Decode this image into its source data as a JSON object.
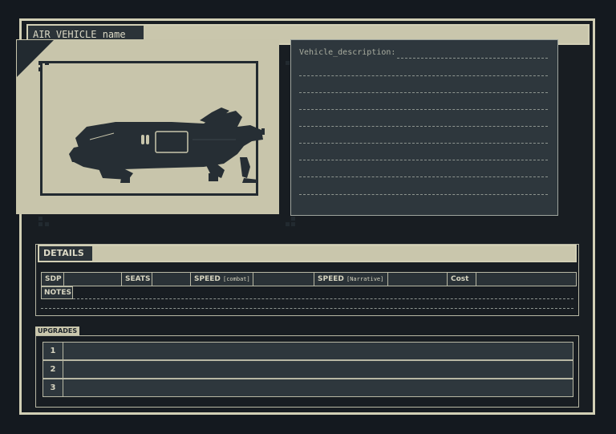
{
  "sheet": {
    "title": "AIR_VEHICLE_name"
  },
  "description": {
    "label": "Vehicle_description:"
  },
  "details": {
    "header": "DETAILS",
    "stats": {
      "sdp": "SDP",
      "seats": "SEATS",
      "speed_combat_label": "SPEED",
      "speed_combat_sub": "[combat]",
      "speed_narrative_label": "SPEED",
      "speed_narrative_sub": "[Narrative]",
      "cost": "Cost"
    },
    "notes_label": "NOTES"
  },
  "upgrades": {
    "label": "UPGRADES",
    "rows": [
      "1",
      "2",
      "3"
    ]
  },
  "colors": {
    "background": "#14191f",
    "paper": "#c9c6ac",
    "panel": "#2e373d",
    "ink": "#222a30"
  },
  "icons": {
    "vehicle": "vehicle-silhouette-icon"
  }
}
